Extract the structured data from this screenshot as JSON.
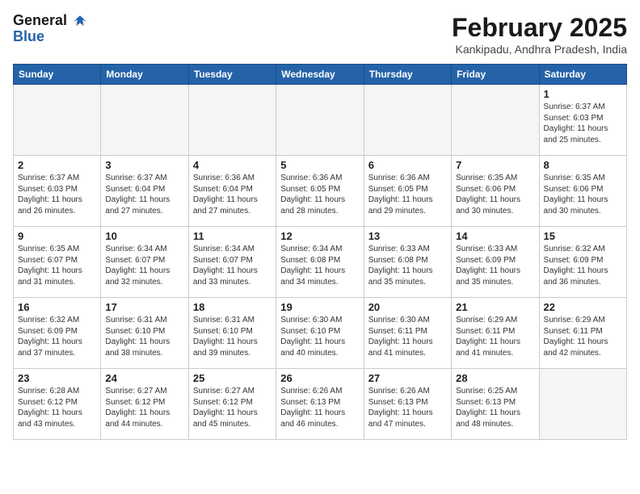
{
  "header": {
    "logo_line1": "General",
    "logo_line2": "Blue",
    "month": "February 2025",
    "location": "Kankipadu, Andhra Pradesh, India"
  },
  "weekdays": [
    "Sunday",
    "Monday",
    "Tuesday",
    "Wednesday",
    "Thursday",
    "Friday",
    "Saturday"
  ],
  "weeks": [
    [
      {
        "day": "",
        "info": ""
      },
      {
        "day": "",
        "info": ""
      },
      {
        "day": "",
        "info": ""
      },
      {
        "day": "",
        "info": ""
      },
      {
        "day": "",
        "info": ""
      },
      {
        "day": "",
        "info": ""
      },
      {
        "day": "1",
        "info": "Sunrise: 6:37 AM\nSunset: 6:03 PM\nDaylight: 11 hours\nand 25 minutes."
      }
    ],
    [
      {
        "day": "2",
        "info": "Sunrise: 6:37 AM\nSunset: 6:03 PM\nDaylight: 11 hours\nand 26 minutes."
      },
      {
        "day": "3",
        "info": "Sunrise: 6:37 AM\nSunset: 6:04 PM\nDaylight: 11 hours\nand 27 minutes."
      },
      {
        "day": "4",
        "info": "Sunrise: 6:36 AM\nSunset: 6:04 PM\nDaylight: 11 hours\nand 27 minutes."
      },
      {
        "day": "5",
        "info": "Sunrise: 6:36 AM\nSunset: 6:05 PM\nDaylight: 11 hours\nand 28 minutes."
      },
      {
        "day": "6",
        "info": "Sunrise: 6:36 AM\nSunset: 6:05 PM\nDaylight: 11 hours\nand 29 minutes."
      },
      {
        "day": "7",
        "info": "Sunrise: 6:35 AM\nSunset: 6:06 PM\nDaylight: 11 hours\nand 30 minutes."
      },
      {
        "day": "8",
        "info": "Sunrise: 6:35 AM\nSunset: 6:06 PM\nDaylight: 11 hours\nand 30 minutes."
      }
    ],
    [
      {
        "day": "9",
        "info": "Sunrise: 6:35 AM\nSunset: 6:07 PM\nDaylight: 11 hours\nand 31 minutes."
      },
      {
        "day": "10",
        "info": "Sunrise: 6:34 AM\nSunset: 6:07 PM\nDaylight: 11 hours\nand 32 minutes."
      },
      {
        "day": "11",
        "info": "Sunrise: 6:34 AM\nSunset: 6:07 PM\nDaylight: 11 hours\nand 33 minutes."
      },
      {
        "day": "12",
        "info": "Sunrise: 6:34 AM\nSunset: 6:08 PM\nDaylight: 11 hours\nand 34 minutes."
      },
      {
        "day": "13",
        "info": "Sunrise: 6:33 AM\nSunset: 6:08 PM\nDaylight: 11 hours\nand 35 minutes."
      },
      {
        "day": "14",
        "info": "Sunrise: 6:33 AM\nSunset: 6:09 PM\nDaylight: 11 hours\nand 35 minutes."
      },
      {
        "day": "15",
        "info": "Sunrise: 6:32 AM\nSunset: 6:09 PM\nDaylight: 11 hours\nand 36 minutes."
      }
    ],
    [
      {
        "day": "16",
        "info": "Sunrise: 6:32 AM\nSunset: 6:09 PM\nDaylight: 11 hours\nand 37 minutes."
      },
      {
        "day": "17",
        "info": "Sunrise: 6:31 AM\nSunset: 6:10 PM\nDaylight: 11 hours\nand 38 minutes."
      },
      {
        "day": "18",
        "info": "Sunrise: 6:31 AM\nSunset: 6:10 PM\nDaylight: 11 hours\nand 39 minutes."
      },
      {
        "day": "19",
        "info": "Sunrise: 6:30 AM\nSunset: 6:10 PM\nDaylight: 11 hours\nand 40 minutes."
      },
      {
        "day": "20",
        "info": "Sunrise: 6:30 AM\nSunset: 6:11 PM\nDaylight: 11 hours\nand 41 minutes."
      },
      {
        "day": "21",
        "info": "Sunrise: 6:29 AM\nSunset: 6:11 PM\nDaylight: 11 hours\nand 41 minutes."
      },
      {
        "day": "22",
        "info": "Sunrise: 6:29 AM\nSunset: 6:11 PM\nDaylight: 11 hours\nand 42 minutes."
      }
    ],
    [
      {
        "day": "23",
        "info": "Sunrise: 6:28 AM\nSunset: 6:12 PM\nDaylight: 11 hours\nand 43 minutes."
      },
      {
        "day": "24",
        "info": "Sunrise: 6:27 AM\nSunset: 6:12 PM\nDaylight: 11 hours\nand 44 minutes."
      },
      {
        "day": "25",
        "info": "Sunrise: 6:27 AM\nSunset: 6:12 PM\nDaylight: 11 hours\nand 45 minutes."
      },
      {
        "day": "26",
        "info": "Sunrise: 6:26 AM\nSunset: 6:13 PM\nDaylight: 11 hours\nand 46 minutes."
      },
      {
        "day": "27",
        "info": "Sunrise: 6:26 AM\nSunset: 6:13 PM\nDaylight: 11 hours\nand 47 minutes."
      },
      {
        "day": "28",
        "info": "Sunrise: 6:25 AM\nSunset: 6:13 PM\nDaylight: 11 hours\nand 48 minutes."
      },
      {
        "day": "",
        "info": ""
      }
    ]
  ]
}
